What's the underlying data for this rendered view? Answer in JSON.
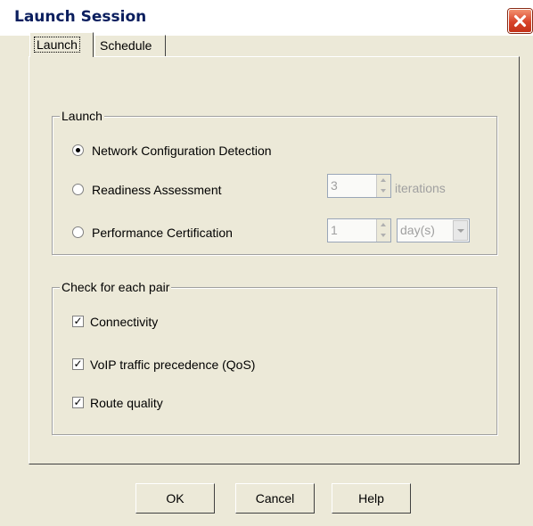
{
  "window": {
    "title": "Launch Session"
  },
  "tabs": [
    {
      "label": "Launch"
    },
    {
      "label": "Schedule"
    }
  ],
  "launch_group": {
    "legend": "Launch",
    "options": [
      {
        "label": "Network Configuration Detection",
        "selected": true
      },
      {
        "label": "Readiness Assessment",
        "selected": false
      },
      {
        "label": "Performance Certification",
        "selected": false
      }
    ],
    "iterations": {
      "value": "3",
      "unit": "iterations"
    },
    "duration": {
      "value": "1",
      "unit": "day(s)"
    }
  },
  "check_group": {
    "legend": "Check for each pair",
    "items": [
      {
        "label": "Connectivity",
        "checked": true
      },
      {
        "label": "VoIP traffic precedence (QoS)",
        "checked": true
      },
      {
        "label": "Route quality",
        "checked": true
      }
    ]
  },
  "buttons": {
    "ok": "OK",
    "cancel": "Cancel",
    "help": "Help"
  },
  "icons": {
    "checkmark": "✓"
  }
}
